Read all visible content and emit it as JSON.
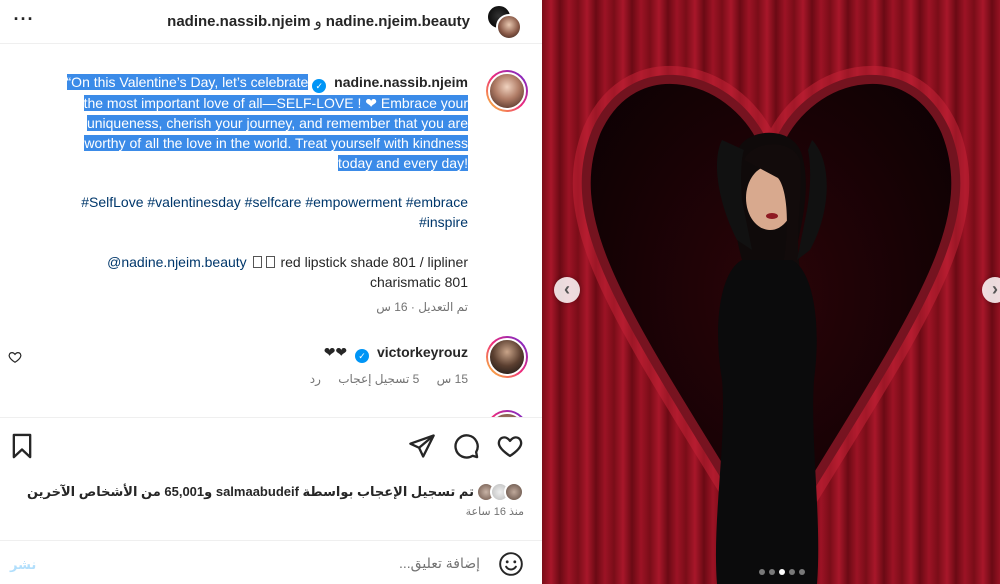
{
  "header": {
    "user1": "nadine.nassib.njeim",
    "joiner": "و",
    "user2": "nadine.njeim.beauty"
  },
  "caption": {
    "username": "nadine.nassib.njeim",
    "line1": "“On this Valentine’s Day, let’s celebrate",
    "line2": "the most important love of all—SELF-LOVE ! ❤ Embrace your",
    "line3": "uniqueness, cherish your journey, and remember that you are",
    "line4": "worthy of all the love in the world. Treat yourself with kindness",
    "line5": "today and every day!",
    "hashtags_line1": "#SelfLove #valentinesday #selfcare #empowerment #embrace",
    "hashtags_line2": "#inspire",
    "mention": "@nadine.njeim.beauty",
    "lip_line1": "red lipstick shade 801 / lipliner",
    "lip_line2": "charismatic 801",
    "edited": "تم التعديل · 16 س"
  },
  "comment": {
    "username": "victorkeyrouz",
    "text": "❤❤",
    "time": "15 س",
    "likes": "5 تسجيل إعجاب",
    "reply": "رد"
  },
  "likes": {
    "text": "تم تسجيل الإعجاب بواسطة salmaabudeif و65,001 من الأشخاص الآخرين",
    "time_ago": "منذ 16 ساعة"
  },
  "add_comment": {
    "placeholder": "إضافة تعليق...",
    "post": "نشر"
  },
  "carousel": {
    "slides": 5,
    "active_index": 2
  },
  "colors": {
    "selection": "#3b8be8",
    "verified": "#0095f6",
    "link": "#00376b",
    "curtain": "#a8172a"
  }
}
